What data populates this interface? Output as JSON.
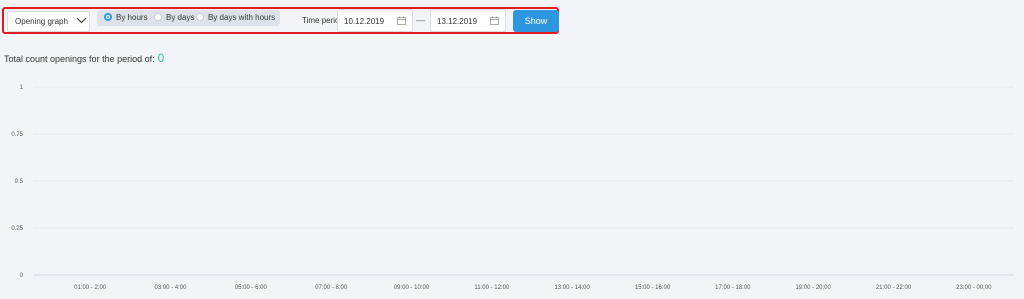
{
  "toolbar": {
    "graph_select": "Opening graph",
    "radios": [
      {
        "label": "By hours",
        "selected": true
      },
      {
        "label": "By days",
        "selected": false
      },
      {
        "label": "By days with hours",
        "selected": false
      }
    ],
    "time_period_label": "Time period",
    "date_from": "10.12.2019",
    "date_separator": "—",
    "date_to": "13.12.2019",
    "show_label": "Show",
    "accent_color": "#2d96e0",
    "highlight_border_color": "#e21b23"
  },
  "summary": {
    "label": "Total count openings for the period of:",
    "value": "0",
    "value_color": "#2fc29a"
  },
  "chart_data": {
    "type": "bar",
    "categories": [
      "01:00 - 2:00",
      "03:00 - 4:00",
      "05:00 - 6:00",
      "07:00 - 8:00",
      "09:00 - 10:00",
      "11:00 - 12:00",
      "13:00 - 14:00",
      "15:00 - 16:00",
      "17:00 - 18:00",
      "19:00 - 20:00",
      "21:00 - 22:00",
      "23:00 - 00:00"
    ],
    "values": [
      0,
      0,
      0,
      0,
      0,
      0,
      0,
      0,
      0,
      0,
      0,
      0
    ],
    "yticks": [
      "1",
      "0.75",
      "0.5",
      "0.25",
      "0"
    ],
    "ylim": [
      0,
      1
    ],
    "grid": true,
    "title": "",
    "xlabel": "",
    "ylabel": ""
  }
}
